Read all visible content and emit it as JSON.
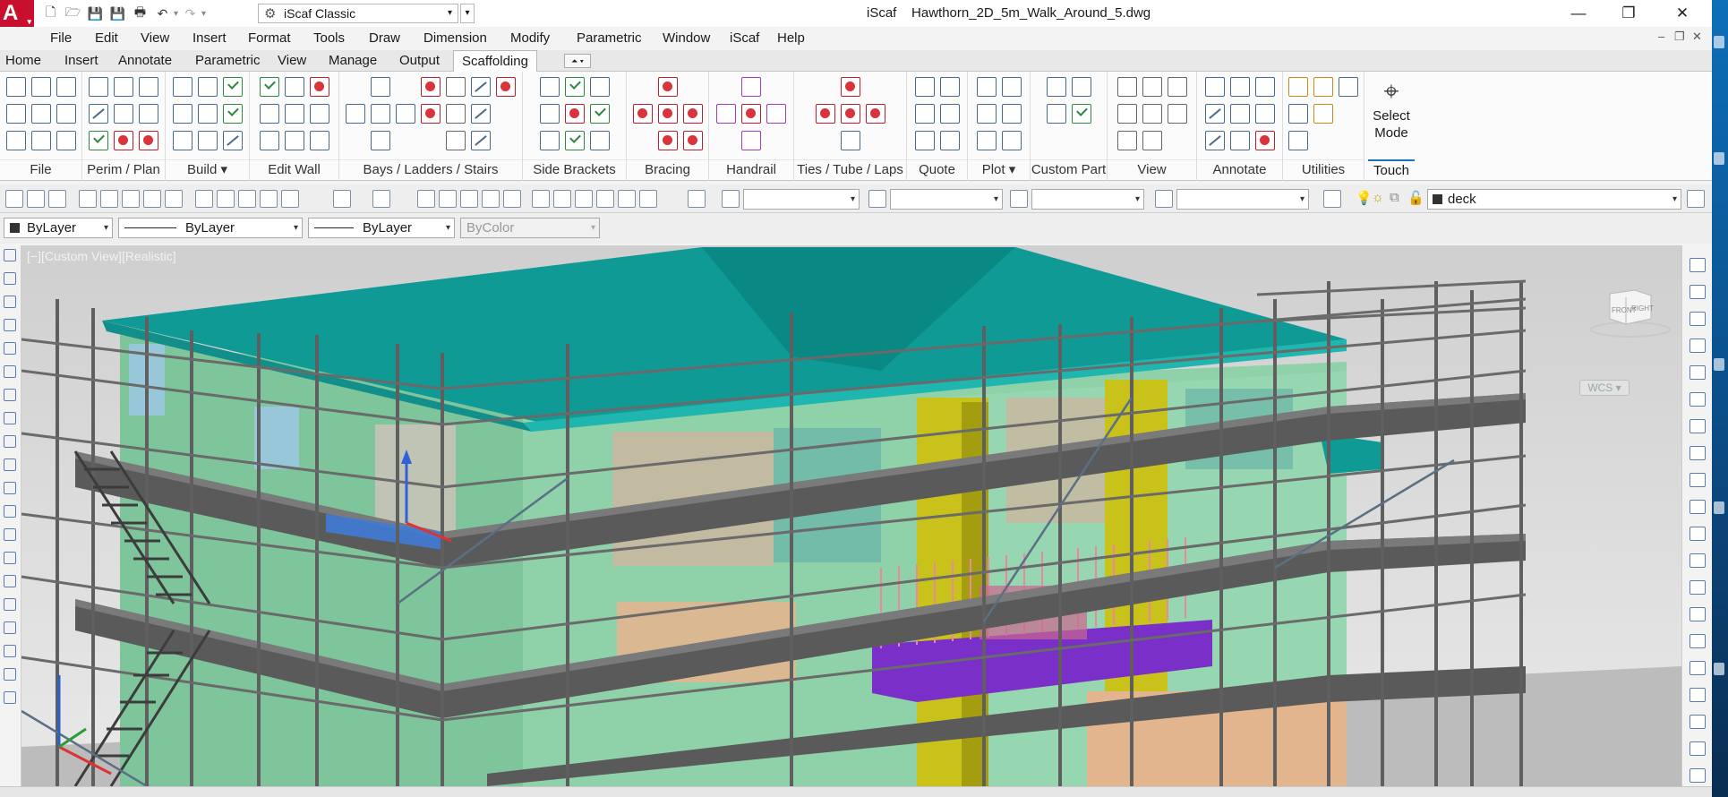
{
  "app": {
    "logo": "A",
    "workspace": "iScaf Classic",
    "title_app": "iScaf",
    "title_file": "Hawthorn_2D_5m_Walk_Around_5.dwg",
    "window_controls": {
      "minimize": "—",
      "restore": "❐",
      "close": "✕"
    }
  },
  "menubar": [
    "File",
    "Edit",
    "View",
    "Insert",
    "Format",
    "Tools",
    "Draw",
    "Dimension",
    "Modify",
    "Parametric",
    "Window",
    "iScaf",
    "Help"
  ],
  "ribbon_tabs": [
    "Home",
    "Insert",
    "Annotate",
    "Parametric",
    "View",
    "Manage",
    "Output",
    "Scaffolding"
  ],
  "active_tab": "Scaffolding",
  "panels": [
    "File",
    "Perim / Plan",
    "Build ▾",
    "Edit Wall",
    "Bays /  Ladders / Stairs",
    "Side Brackets",
    "Bracing",
    "Handrail",
    "Ties / Tube / Laps",
    "Quote",
    "Plot ▾",
    "Custom Part",
    "View",
    "Annotate",
    "Utilities"
  ],
  "select_mode": {
    "line1": "Select",
    "line2": "Mode",
    "panel": "Touch"
  },
  "toolbar": {
    "layer_value": "deck"
  },
  "properties": {
    "color": "ByLayer",
    "linetype": "ByLayer",
    "lineweight": "ByLayer",
    "plotstyle": "ByColor"
  },
  "viewport": {
    "label": "[−][Custom View][Realistic]",
    "viewcube_front": "FRONT",
    "viewcube_right": "RIGHT",
    "wcs": "WCS ▾"
  },
  "colors": {
    "brand_red": "#c8102e",
    "roof_teal": "#0f9a96",
    "wall_mint": "#8fd1a8",
    "deck_gray": "#555555",
    "accent_purple": "#7b2fc9",
    "accent_yellow": "#c9c21a",
    "selection_blue": "#1c6fbd"
  }
}
